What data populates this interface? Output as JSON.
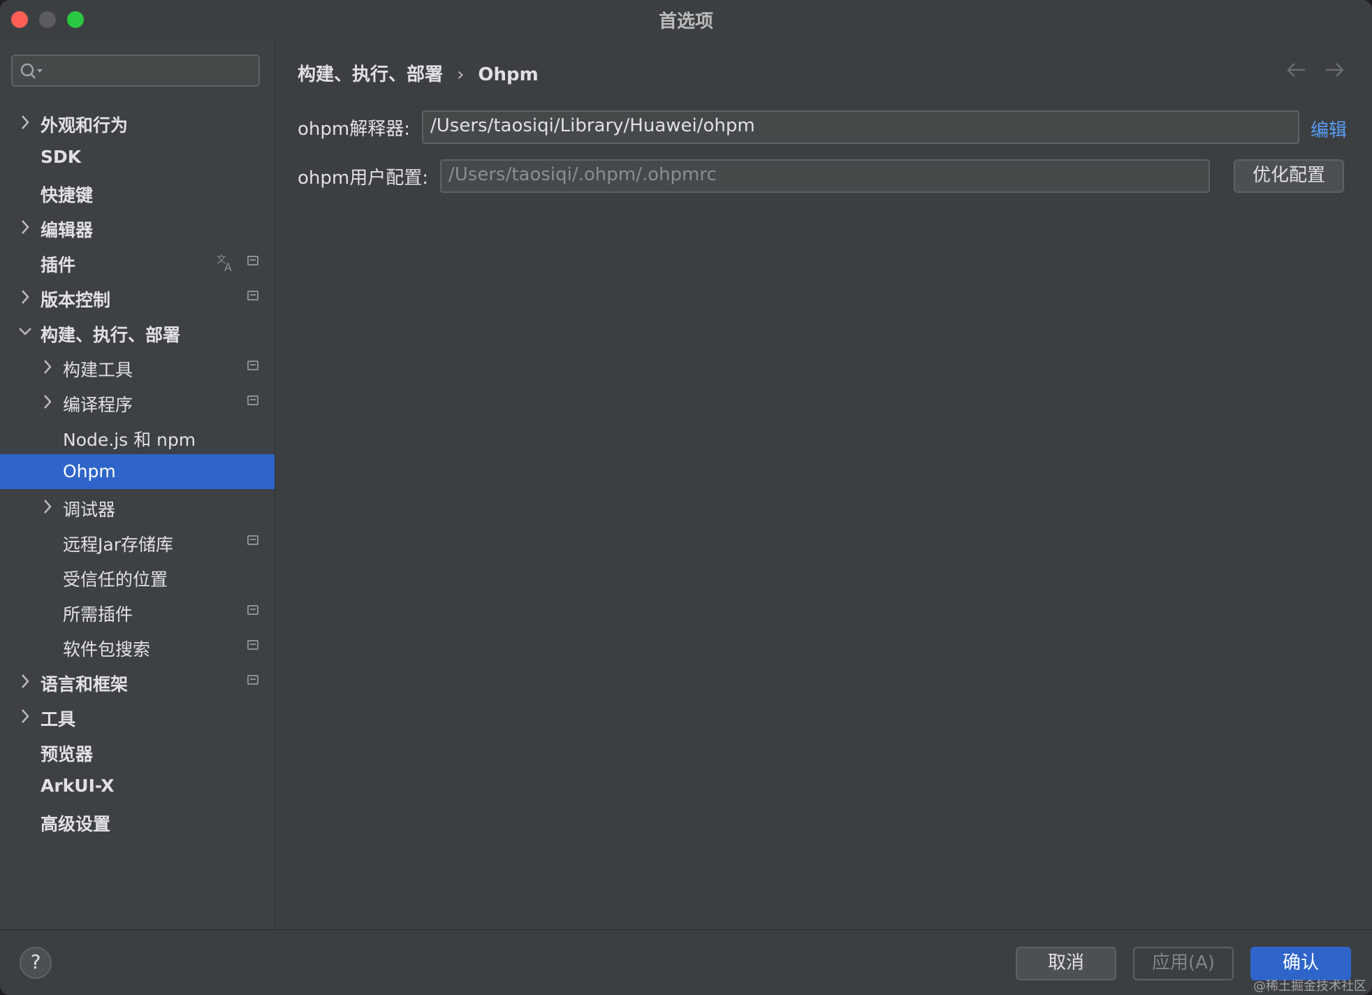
{
  "window": {
    "title": "首选项"
  },
  "sidebar": {
    "search": {
      "value": ""
    },
    "items": [
      {
        "label": "外观和行为",
        "level": 0,
        "chevron": "right",
        "bold": true,
        "badge": false
      },
      {
        "label": "SDK",
        "level": 0,
        "chevron": "none",
        "bold": true,
        "badge": false
      },
      {
        "label": "快捷键",
        "level": 0,
        "chevron": "none",
        "bold": true,
        "badge": false
      },
      {
        "label": "编辑器",
        "level": 0,
        "chevron": "right",
        "bold": true,
        "badge": false
      },
      {
        "label": "插件",
        "level": 0,
        "chevron": "none",
        "bold": true,
        "badge": true,
        "translate": true
      },
      {
        "label": "版本控制",
        "level": 0,
        "chevron": "right",
        "bold": true,
        "badge": true
      },
      {
        "label": "构建、执行、部署",
        "level": 0,
        "chevron": "down",
        "bold": true,
        "badge": false
      },
      {
        "label": "构建工具",
        "level": 1,
        "chevron": "right",
        "bold": false,
        "badge": true
      },
      {
        "label": "编译程序",
        "level": 1,
        "chevron": "right",
        "bold": false,
        "badge": true
      },
      {
        "label": "Node.js 和 npm",
        "level": 1,
        "chevron": "none",
        "bold": false,
        "badge": false
      },
      {
        "label": "Ohpm",
        "level": 1,
        "chevron": "none",
        "bold": false,
        "badge": false,
        "selected": true
      },
      {
        "label": "调试器",
        "level": 1,
        "chevron": "right",
        "bold": false,
        "badge": false
      },
      {
        "label": "远程Jar存储库",
        "level": 1,
        "chevron": "none",
        "bold": false,
        "badge": true
      },
      {
        "label": "受信任的位置",
        "level": 1,
        "chevron": "none",
        "bold": false,
        "badge": false
      },
      {
        "label": "所需插件",
        "level": 1,
        "chevron": "none",
        "bold": false,
        "badge": true
      },
      {
        "label": "软件包搜索",
        "level": 1,
        "chevron": "none",
        "bold": false,
        "badge": true
      },
      {
        "label": "语言和框架",
        "level": 0,
        "chevron": "right",
        "bold": true,
        "badge": true
      },
      {
        "label": "工具",
        "level": 0,
        "chevron": "right",
        "bold": true,
        "badge": false
      },
      {
        "label": "预览器",
        "level": 0,
        "chevron": "none",
        "bold": true,
        "badge": false
      },
      {
        "label": "ArkUI-X",
        "level": 0,
        "chevron": "none",
        "bold": true,
        "badge": false
      },
      {
        "label": "高级设置",
        "level": 0,
        "chevron": "none",
        "bold": true,
        "badge": false
      }
    ]
  },
  "main": {
    "breadcrumb": {
      "parent": "构建、执行、部署",
      "separator": "›",
      "current": "Ohpm"
    },
    "interpreter": {
      "label": "ohpm解释器:",
      "value": "/Users/taosiqi/Library/Huawei/ohpm",
      "link": "编辑"
    },
    "user_config": {
      "label": "ohpm用户配置:",
      "placeholder": "/Users/taosiqi/.ohpm/.ohpmrc",
      "button": "优化配置"
    }
  },
  "footer": {
    "help": "?",
    "cancel": "取消",
    "apply": "应用(A)",
    "ok": "确认",
    "watermark": "@稀土掘金技术社区"
  },
  "colors": {
    "accent": "#2f65ca",
    "link": "#589df6",
    "close": "#ff5f57",
    "maximize": "#28c840"
  }
}
